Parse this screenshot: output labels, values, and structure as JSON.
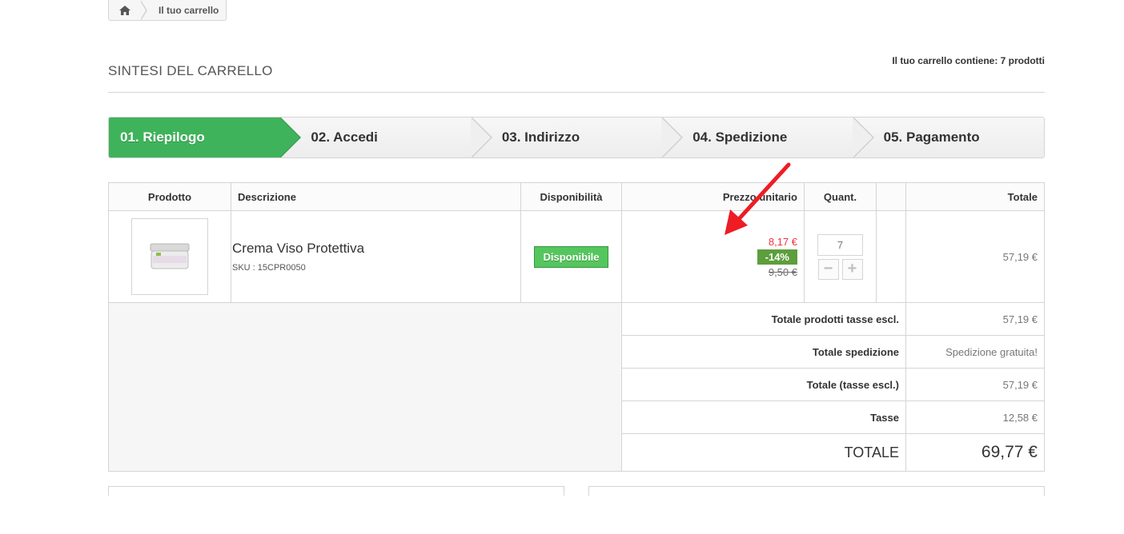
{
  "breadcrumb": {
    "home_icon": "home-icon",
    "current": "Il tuo carrello"
  },
  "heading": {
    "title": "SINTESI DEL CARRELLO",
    "counter": "Il tuo carrello contiene: 7 prodotti"
  },
  "steps": [
    {
      "label": "01. Riepilogo",
      "active": true
    },
    {
      "label": "02. Accedi",
      "active": false
    },
    {
      "label": "03. Indirizzo",
      "active": false
    },
    {
      "label": "04. Spedizione",
      "active": false
    },
    {
      "label": "05. Pagamento",
      "active": false
    }
  ],
  "table": {
    "headers": {
      "product": "Prodotto",
      "description": "Descrizione",
      "availability": "Disponibilità",
      "unit_price": "Prezzo unitario",
      "quantity": "Quant.",
      "total": "Totale"
    },
    "item": {
      "name": "Crema Viso Protettiva",
      "sku": "SKU : 15CPR0050",
      "availability": "Disponibile",
      "price_special": "8,17 €",
      "price_reduction": "-14%",
      "price_old": "9,50 €",
      "quantity": "7",
      "total": "57,19 €"
    },
    "footer": {
      "products_label": "Totale prodotti tasse escl.",
      "products_value": "57,19 €",
      "shipping_label": "Totale spedizione",
      "shipping_value": "Spedizione gratuita!",
      "total_excl_label": "Totale (tasse escl.)",
      "total_excl_value": "57,19 €",
      "tax_label": "Tasse",
      "tax_value": "12,58 €",
      "grand_label": "TOTALE",
      "grand_value": "69,77 €"
    }
  },
  "colors": {
    "step_active": "#3fb35b",
    "available_badge": "#55c65e",
    "discount_badge": "#5d9e3d",
    "special_price": "#f13340",
    "annotation_arrow": "#ee1c24"
  }
}
